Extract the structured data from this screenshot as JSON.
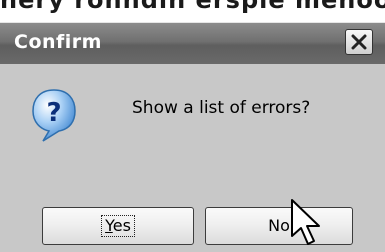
{
  "background": {
    "partial_text": "nery ronndin erspie menoot"
  },
  "dialog": {
    "title": "Confirm",
    "message": "Show a list of errors?",
    "icon": "question-icon",
    "close_icon": "close-icon",
    "buttons": {
      "yes_label": "Yes",
      "no_label": "No"
    },
    "focused_button": "Yes",
    "colors": {
      "titlebar": "#707070",
      "body": "#c8c8c8",
      "icon_bubble": "#5aa0e0"
    }
  },
  "cursor": {
    "icon": "arrow-pointer-icon"
  }
}
